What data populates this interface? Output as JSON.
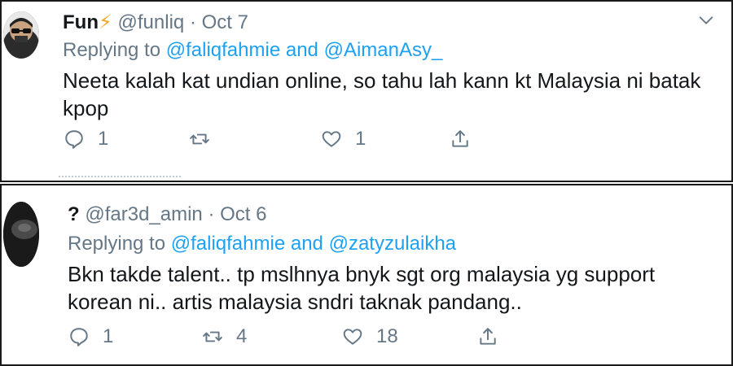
{
  "tweets": [
    {
      "display_name": "Fun",
      "emoji": "⚡",
      "handle": "@funliq",
      "separator": "·",
      "date": "Oct 7",
      "replying_prefix": "Replying to",
      "mention_1": "@faliqfahmie",
      "mention_joiner": "and",
      "mention_2": "@AimanAsy_",
      "text": "Neeta kalah kat undian online, so tahu lah kann kt Malaysia ni batak kpop",
      "reply_count": "1",
      "retweet_count": "",
      "like_count": "1"
    },
    {
      "display_name": "?",
      "handle": "@far3d_amin",
      "separator": "·",
      "date": "Oct 6",
      "replying_prefix": "Replying to",
      "mention_1": "@faliqfahmie",
      "mention_joiner": "and",
      "mention_2": "@zatyzulaikha",
      "text": "Bkn takde talent.. tp mslhnya bnyk sgt org malaysia yg support korean ni.. artis malaysia sndri taknak pandang..",
      "reply_count": "1",
      "retweet_count": "4",
      "like_count": "18"
    }
  ],
  "colors": {
    "link": "#1da1f2",
    "muted": "#657786",
    "text": "#14171a",
    "bolt": "#f5a623"
  },
  "icons": [
    "reply-icon",
    "retweet-icon",
    "like-icon",
    "share-icon",
    "chevron-down-icon"
  ]
}
